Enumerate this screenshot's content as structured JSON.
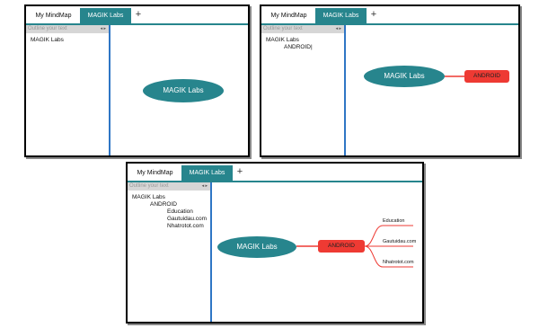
{
  "windows": [
    {
      "tabs": [
        "My MindMap",
        "MAGIK Labs"
      ],
      "plus": "+",
      "outline": {
        "placeholder": "Outline your text",
        "arrows": "◂ ▸",
        "lines": [
          "MAGIK Labs"
        ]
      },
      "root": "MAGIK Labs"
    },
    {
      "tabs": [
        "My MindMap",
        "MAGIK Labs"
      ],
      "plus": "+",
      "outline": {
        "placeholder": "Outline your text",
        "arrows": "◂ ▸",
        "lines": [
          "MAGIK Labs",
          "ANDROID|"
        ]
      },
      "root": "MAGIK Labs",
      "child": "ANDROID"
    },
    {
      "tabs": [
        "My MindMap",
        "MAGIK Labs"
      ],
      "plus": "+",
      "outline": {
        "placeholder": "Outline your text",
        "arrows": "◂ ▸",
        "lines": [
          "MAGIK Labs",
          "ANDROID",
          "Education",
          "Gautuidau.com",
          "Nhatrotot.com"
        ]
      },
      "root": "MAGIK Labs",
      "child": "ANDROID",
      "leaves": [
        "Education",
        "Gautuidau.com",
        "Nhatrotot.com"
      ]
    }
  ],
  "colors": {
    "accent": "#27858d",
    "node_red": "#ee3a33",
    "outline_border": "#2f76c5"
  }
}
